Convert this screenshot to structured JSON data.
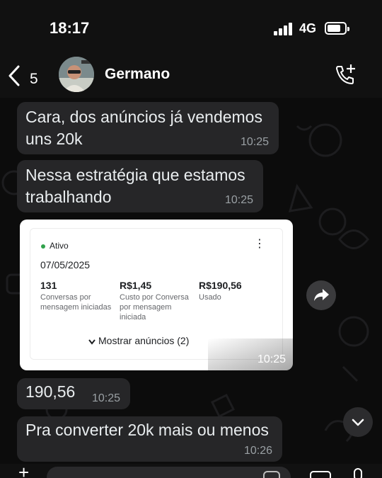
{
  "status_bar": {
    "time": "18:17",
    "network": "4G"
  },
  "header": {
    "back_count": "5",
    "contact_name": "Germano"
  },
  "messages": [
    {
      "text": "Cara, dos anúncios já vendemos uns 20k",
      "time": "10:25"
    },
    {
      "text": "Nessa estratégia que estamos trabalhando",
      "time": "10:25"
    },
    {
      "text": "190,56",
      "time": "10:25"
    },
    {
      "text": "Pra converter 20k mais ou menos",
      "time": "10:26"
    }
  ],
  "media_card": {
    "status": "Ativo",
    "date": "07/05/2025",
    "metrics": [
      {
        "value": "131",
        "label": "Conversas por mensagem iniciadas"
      },
      {
        "value": "R$1,45",
        "label": "Custo por Conversa por mensagem iniciada"
      },
      {
        "value": "R$190,56",
        "label": "Usado"
      }
    ],
    "show_ads": "Mostrar anúncios (2)",
    "time": "10:25"
  },
  "colors": {
    "bubble": "#262628",
    "active_green": "#31a24c",
    "chat_bg": "#0c0c0c"
  }
}
